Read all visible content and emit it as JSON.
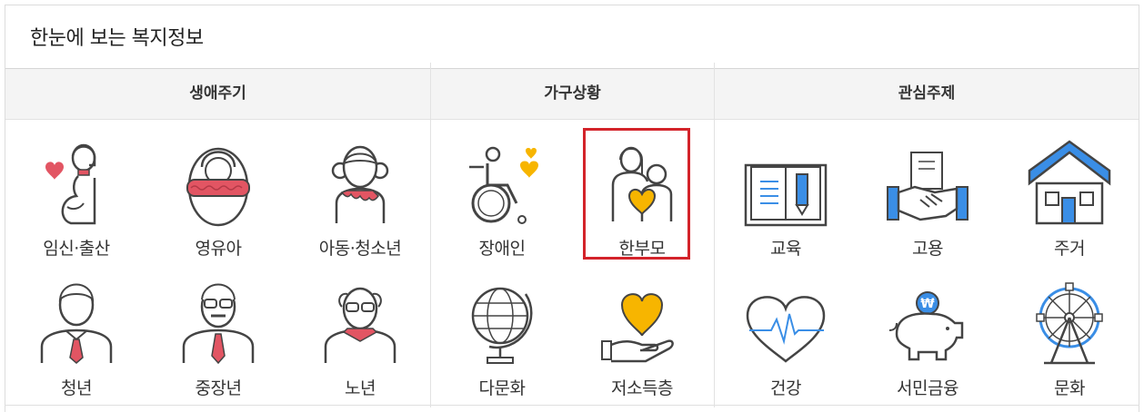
{
  "title": "한눈에 보는 복지정보",
  "columns": [
    {
      "label": "생애주기"
    },
    {
      "label": "가구상황"
    },
    {
      "label": "관심주제"
    }
  ],
  "items": [
    {
      "label": "임신·출산",
      "icon": "pregnant-woman-icon"
    },
    {
      "label": "영유아",
      "icon": "swaddled-baby-icon"
    },
    {
      "label": "아동·청소년",
      "icon": "child-girl-icon"
    },
    {
      "label": "장애인",
      "icon": "wheelchair-icon"
    },
    {
      "label": "한부모",
      "icon": "single-parent-icon"
    },
    {
      "label": "교육",
      "icon": "book-pencil-icon"
    },
    {
      "label": "고용",
      "icon": "handshake-icon"
    },
    {
      "label": "주거",
      "icon": "house-icon"
    },
    {
      "label": "청년",
      "icon": "young-man-icon"
    },
    {
      "label": "중장년",
      "icon": "middle-aged-man-icon"
    },
    {
      "label": "노년",
      "icon": "elderly-man-icon"
    },
    {
      "label": "다문화",
      "icon": "globe-icon"
    },
    {
      "label": "저소득층",
      "icon": "heart-in-hand-icon"
    },
    {
      "label": "건강",
      "icon": "heart-pulse-icon"
    },
    {
      "label": "서민금융",
      "icon": "piggy-bank-icon"
    },
    {
      "label": "문화",
      "icon": "ferris-wheel-icon"
    }
  ],
  "selected_item": "한부모",
  "colors": {
    "accent_red": "#e25563",
    "accent_yellow": "#f7b500",
    "accent_blue": "#3a8ee6",
    "selection_border": "#d3232a"
  }
}
